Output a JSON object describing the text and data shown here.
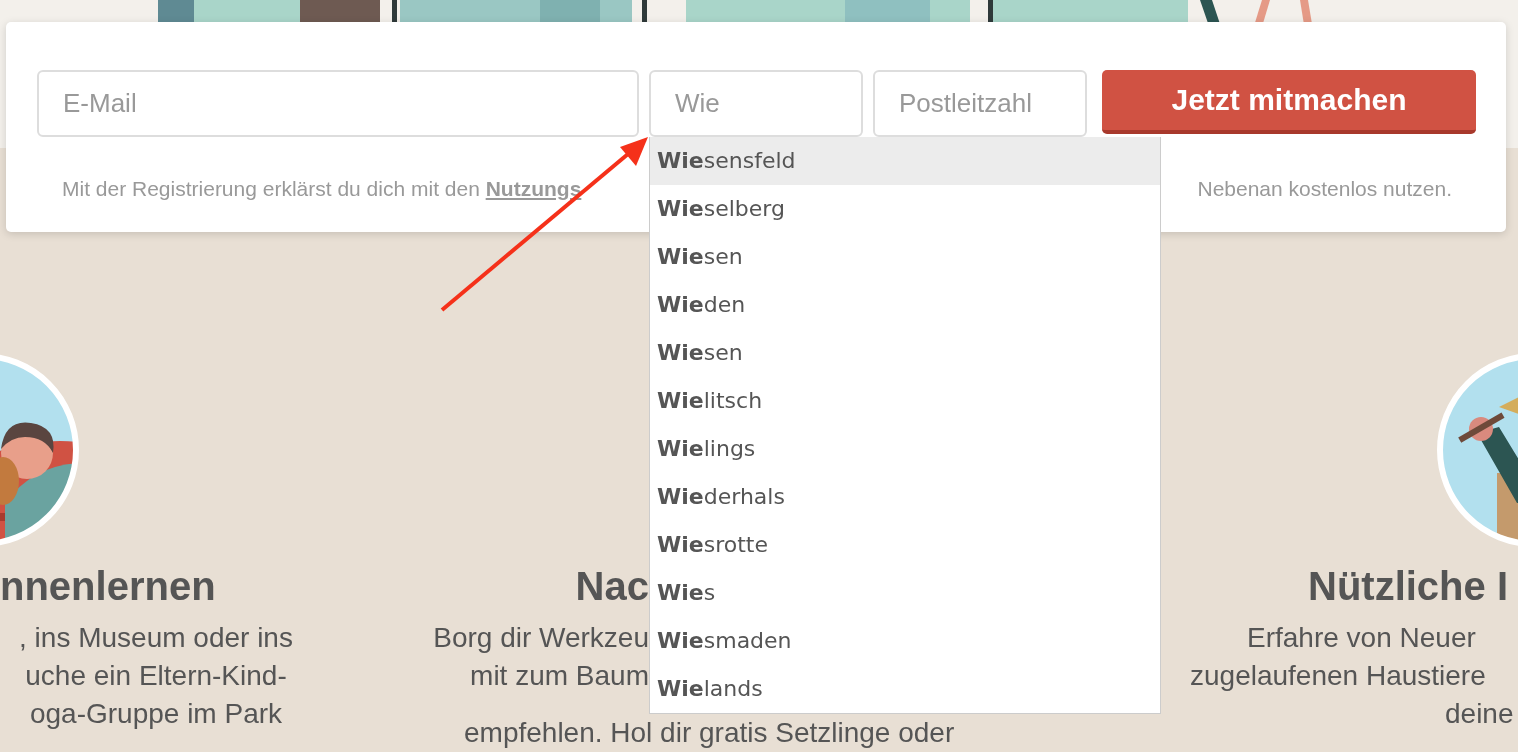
{
  "signup": {
    "email": {
      "placeholder": "E-Mail"
    },
    "city": {
      "value": "Wie"
    },
    "postcode": {
      "placeholder": "Postleitzahl"
    },
    "button": "Jetzt mitmachen",
    "consent": {
      "text": "Mit der Registrierung erklärst du dich mit den",
      "link": "Nutzungs",
      "text_end": "Nebenan kostenlos nutzen."
    }
  },
  "autocomplete": [
    {
      "label": "**Wie**sensfeld",
      "selected": true
    },
    {
      "label": "**Wie**selberg",
      "selected": false
    },
    {
      "label": "**Wie**sen",
      "selected": false
    },
    {
      "label": "**Wie**den",
      "selected": false
    },
    {
      "label": "**Wie**sen",
      "selected": false
    },
    {
      "label": "**Wie**litsch",
      "selected": false
    },
    {
      "label": "**Wie**lings",
      "selected": false
    },
    {
      "label": "**Wie**derhals",
      "selected": false
    },
    {
      "label": "**Wie**srotte",
      "selected": false
    },
    {
      "label": "**Wie**s",
      "selected": false
    },
    {
      "label": "**Wie**smaden",
      "selected": false
    },
    {
      "label": "**Wie**lands",
      "selected": false
    }
  ],
  "annotation": {
    "kind": "arrow"
  },
  "features": [
    {
      "title": "nnenlernen",
      "lines": [
        ", ins Museum oder ins",
        "uche ein Eltern-Kind-",
        "oga-Gruppe im Park"
      ]
    },
    {
      "title": "Nac",
      "lines": [
        "Borg dir Werkzeu",
        "mit zum Baum",
        "empfehlen. Hol dir gratis Setzlinge oder"
      ]
    },
    {
      "title": "Nützliche I",
      "lines": [
        "Erfahre von Neuer",
        "zugelaufenen Haustiere",
        "deine"
      ]
    }
  ]
}
